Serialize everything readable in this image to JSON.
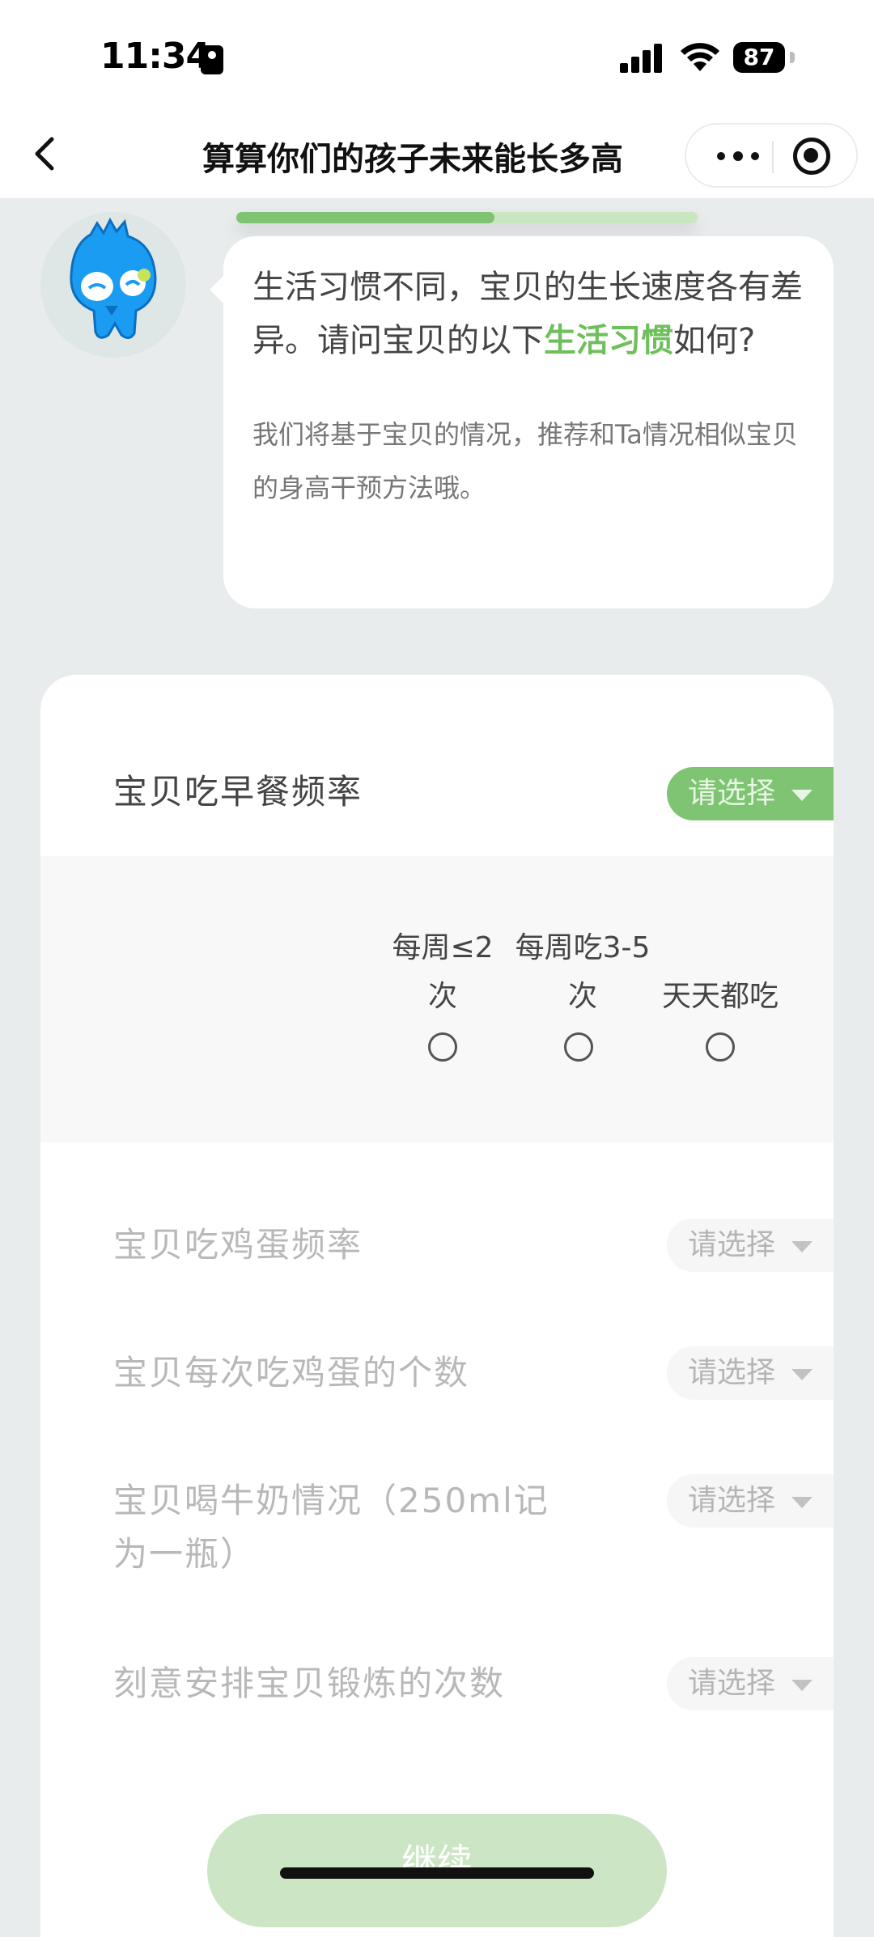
{
  "status_bar": {
    "time": "11:34",
    "battery": "87"
  },
  "nav": {
    "title": "算算你们的孩子未来能长多高"
  },
  "progress": {
    "value": 0.56
  },
  "bubble": {
    "text_before": "生活习惯不同，宝贝的生长速度各有差异。请问宝贝的以下",
    "highlight": "生活习惯",
    "text_after": "如何?",
    "subtext": "我们将基于宝贝的情况，推荐和Ta情况相似宝贝的身高干预方法哦。"
  },
  "questions": [
    {
      "label": "宝贝吃早餐频率",
      "select_label": "请选择"
    },
    {
      "label": "宝贝吃鸡蛋频率",
      "select_label": "请选择"
    },
    {
      "label": "宝贝每次吃鸡蛋的个数",
      "select_label": "请选择"
    },
    {
      "label": "宝贝喝牛奶情况（250ml记为一瓶）",
      "select_label": "请选择"
    },
    {
      "label": "刻意安排宝贝锻炼的次数",
      "select_label": "请选择"
    }
  ],
  "options": [
    {
      "label": "每周≤2次"
    },
    {
      "label": "每周吃3-5次"
    },
    {
      "label": "天天都吃"
    }
  ],
  "continue_label": "继续",
  "colors": {
    "accent": "#7fc473",
    "accent_light": "#cce6c5",
    "background": "#e8ecec"
  }
}
